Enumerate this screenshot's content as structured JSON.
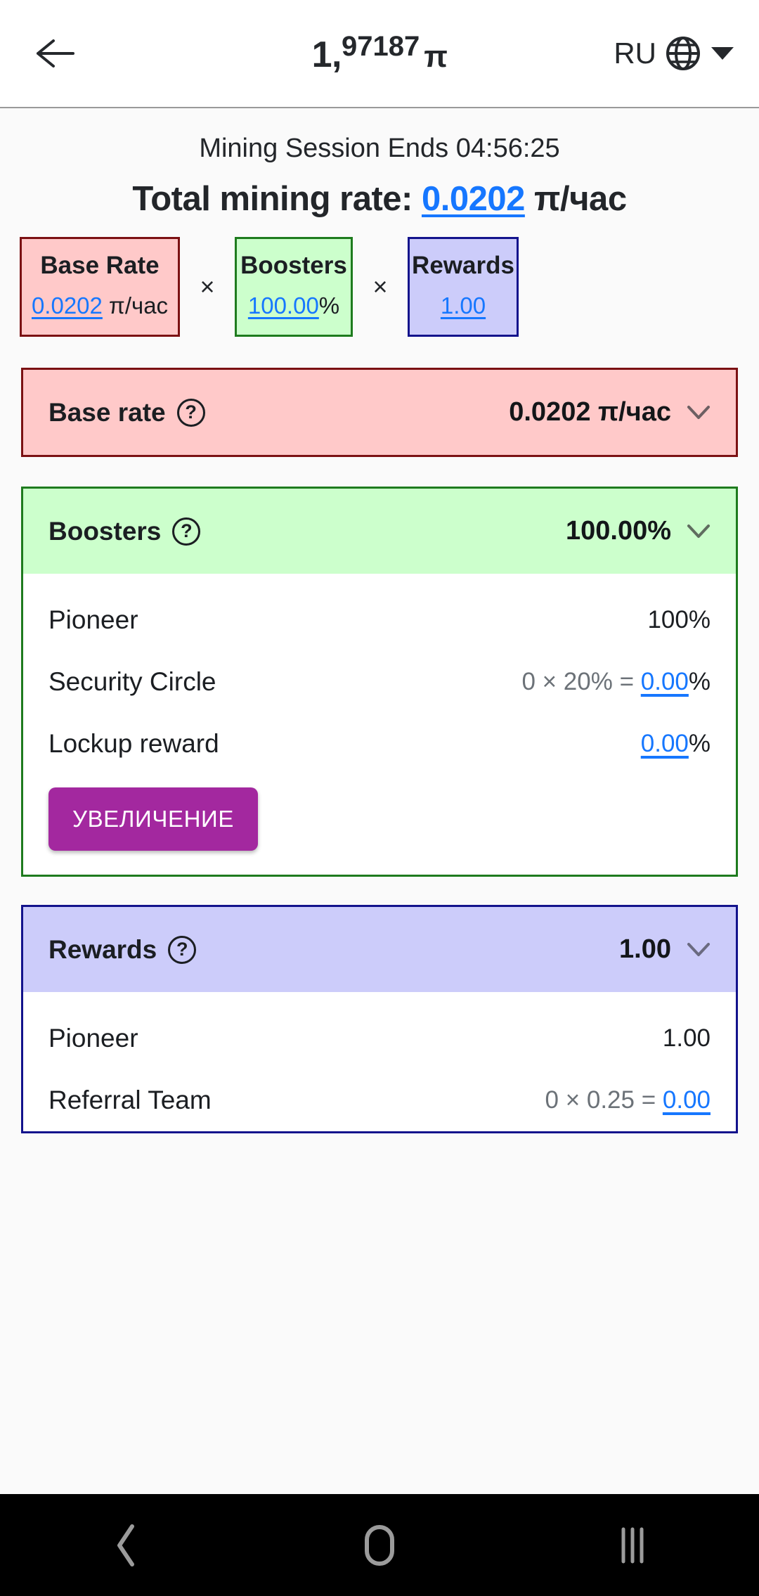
{
  "appbar": {
    "back_icon": "arrow-left-icon",
    "balance_int": "1,",
    "balance_frac": "97187",
    "balance_unit": "π",
    "language_code": "RU",
    "globe_icon": "globe-icon",
    "caret_icon": "chevron-down-icon"
  },
  "main": {
    "session_text": "Mining Session Ends 04:56:25",
    "total_rate_label": "Total mining rate:",
    "total_rate_value": "0.0202",
    "total_rate_unit": "π/час"
  },
  "formula": {
    "multiply_symbol": "×",
    "boxes": [
      {
        "title": "Base Rate",
        "value": "0.0202",
        "suffix": " π/час",
        "bg": "#ffc9c9",
        "border": "#7b1113"
      },
      {
        "title": "Boosters",
        "value": "100.00",
        "suffix": "%",
        "bg": "#ccffcc",
        "border": "#1e7b1e"
      },
      {
        "title": "Rewards",
        "value": "1.00",
        "suffix": "",
        "bg": "#ccccfa",
        "border": "#13138c"
      }
    ]
  },
  "sections": {
    "base_rate": {
      "title": "Base rate",
      "help_icon": "question-mark-icon",
      "value": "0.0202 π/час",
      "chevron_icon": "chevron-down-icon"
    },
    "boosters": {
      "title": "Boosters",
      "help_icon": "question-mark-icon",
      "value": "100.00%",
      "chevron_icon": "chevron-down-icon",
      "rows": [
        {
          "label": "Pioneer",
          "prefix": "",
          "value": "100%",
          "suffix": "",
          "linked": false
        },
        {
          "label": "Security Circle",
          "prefix": "0 × 20% = ",
          "value": "0.00",
          "suffix": "%",
          "linked": true
        },
        {
          "label": "Lockup reward",
          "prefix": "",
          "value": "0.00",
          "suffix": "%",
          "linked": true
        }
      ],
      "button_label": "УВЕЛИЧЕНИЕ",
      "button_color": "#a3289f"
    },
    "rewards": {
      "title": "Rewards",
      "help_icon": "question-mark-icon",
      "value": "1.00",
      "chevron_icon": "chevron-down-icon",
      "rows": [
        {
          "label": "Pioneer",
          "prefix": "",
          "value": "1.00",
          "suffix": "",
          "linked": false
        },
        {
          "label": "Referral Team",
          "prefix": "0 × 0.25 = ",
          "value": "0.00",
          "suffix": "",
          "linked": true
        }
      ]
    }
  },
  "navbar": {
    "back_icon": "nav-back-icon",
    "home_icon": "nav-home-icon",
    "recents_icon": "nav-recents-icon"
  },
  "colors": {
    "accent_link": "#1677ff",
    "pink_bg": "#ffc9c9",
    "pink_border": "#7b1113",
    "green_bg": "#ccffcc",
    "green_border": "#1e7b1e",
    "lavender_bg": "#ccccfa",
    "lavender_border": "#13138c",
    "button_magenta": "#a3289f"
  }
}
